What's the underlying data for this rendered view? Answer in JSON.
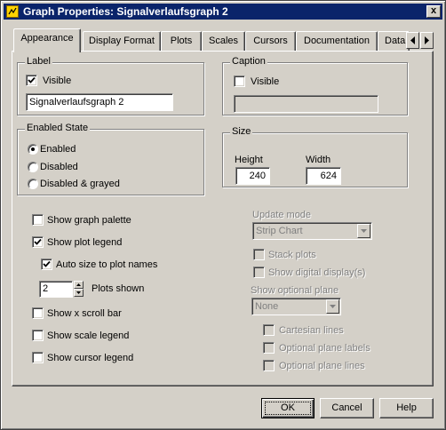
{
  "window": {
    "title": "Graph Properties: Signalverlaufsgraph 2",
    "close_glyph": "x"
  },
  "tabs": [
    {
      "label": "Appearance",
      "active": true
    },
    {
      "label": "Display Format"
    },
    {
      "label": "Plots"
    },
    {
      "label": "Scales"
    },
    {
      "label": "Cursors"
    },
    {
      "label": "Documentation"
    },
    {
      "label": "Data"
    }
  ],
  "label_group": {
    "title": "Label",
    "visible_label": "Visible",
    "visible_checked": true,
    "text_value": "Signalverlaufsgraph 2"
  },
  "caption_group": {
    "title": "Caption",
    "visible_label": "Visible",
    "visible_checked": false,
    "text_value": ""
  },
  "enabled_state": {
    "title": "Enabled State",
    "options": [
      "Enabled",
      "Disabled",
      "Disabled & grayed"
    ],
    "selected": "Enabled"
  },
  "size_group": {
    "title": "Size",
    "height_label": "Height",
    "height_value": "240",
    "width_label": "Width",
    "width_value": "624"
  },
  "options": {
    "show_graph_palette": {
      "label": "Show graph palette",
      "checked": false
    },
    "show_plot_legend": {
      "label": "Show plot legend",
      "checked": true
    },
    "auto_size": {
      "label": "Auto size to plot names",
      "checked": true
    },
    "plots_shown_value": "2",
    "plots_shown_label": "Plots shown",
    "show_x_scroll": {
      "label": "Show x scroll bar",
      "checked": false
    },
    "show_scale_legend": {
      "label": "Show scale legend",
      "checked": false
    },
    "show_cursor_legend": {
      "label": "Show cursor legend",
      "checked": false
    }
  },
  "update_mode": {
    "label": "Update mode",
    "value": "Strip Chart",
    "stack_plots": "Stack plots",
    "show_digital": "Show digital display(s)",
    "optional_plane_label": "Show optional plane",
    "optional_plane_value": "None",
    "cartesian_lines": "Cartesian lines",
    "plane_labels": "Optional plane labels",
    "plane_lines": "Optional plane lines"
  },
  "buttons": {
    "ok": "OK",
    "cancel": "Cancel",
    "help": "Help"
  },
  "colors": {
    "title_bar": "#0a246a",
    "face": "#d4d0c8",
    "disabled_text": "#808080"
  }
}
